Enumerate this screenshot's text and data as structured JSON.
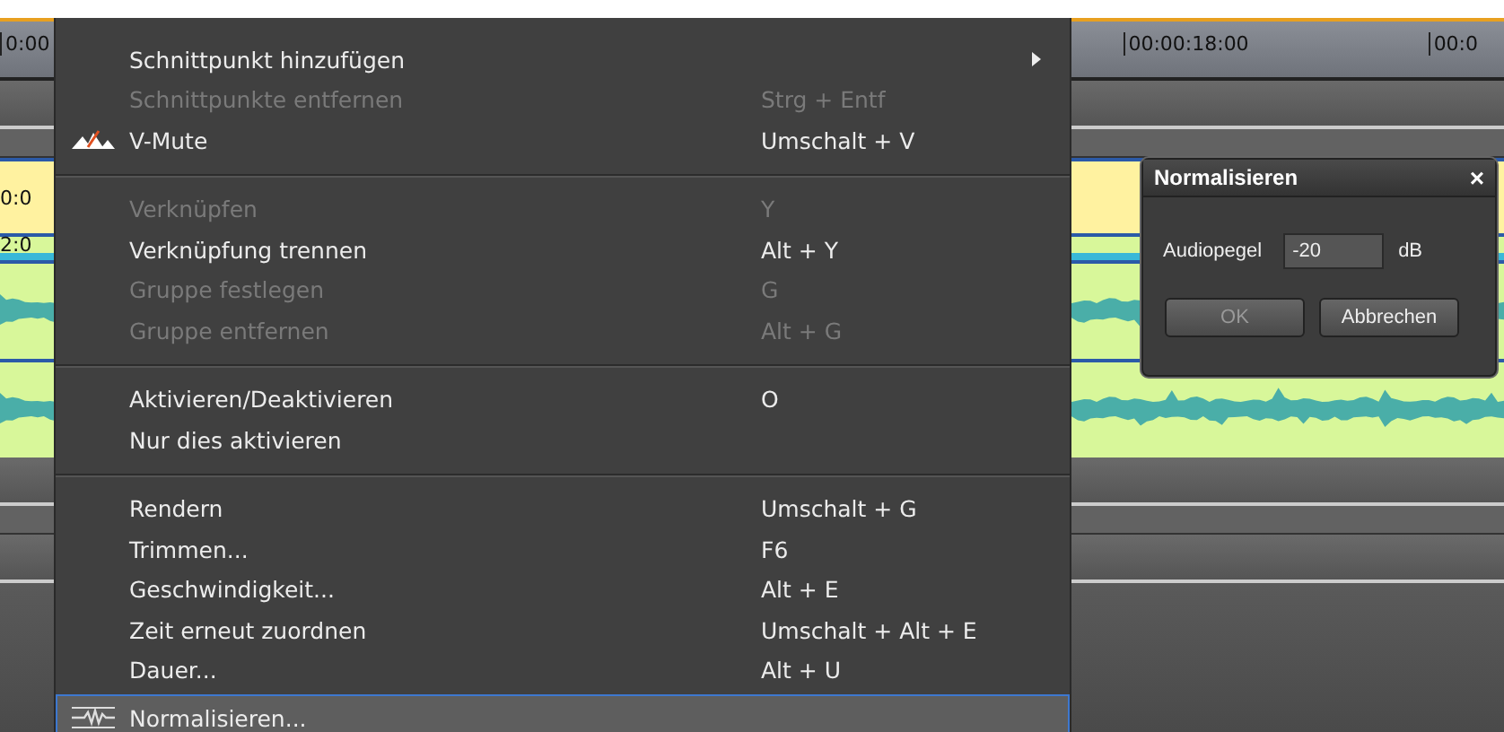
{
  "timeline": {
    "ruler_labels": [
      "0:00",
      "00:00:18:00",
      "00:0"
    ],
    "tracks": [
      {
        "kind": "band"
      },
      {
        "kind": "band-light"
      },
      {
        "kind": "video",
        "label": "0:0"
      },
      {
        "kind": "title",
        "label": "2:0"
      },
      {
        "kind": "audio"
      },
      {
        "kind": "audio"
      },
      {
        "kind": "band"
      },
      {
        "kind": "band-light"
      },
      {
        "kind": "band"
      }
    ]
  },
  "menu": {
    "items": [
      {
        "kind": "plain",
        "label": "Schnittpunkt hinzufügen",
        "disabled": false,
        "submenu": true,
        "selected": false
      },
      {
        "kind": "plain",
        "label": "Schnittpunkte entfernen",
        "shortcut": "Strg + Entf",
        "disabled": true,
        "submenu": false,
        "selected": false
      },
      {
        "kind": "mute",
        "label": "V-Mute",
        "shortcut": "Umschalt + V",
        "disabled": false,
        "submenu": false,
        "selected": false
      },
      {
        "kind": "separator"
      },
      {
        "kind": "plain",
        "label": "Verknüpfen",
        "shortcut": "Y",
        "disabled": true,
        "submenu": false,
        "selected": false
      },
      {
        "kind": "plain",
        "label": "Verknüpfung trennen",
        "shortcut": "Alt + Y",
        "disabled": false,
        "submenu": false,
        "selected": false
      },
      {
        "kind": "plain",
        "label": "Gruppe festlegen",
        "shortcut": "G",
        "disabled": true,
        "submenu": false,
        "selected": false
      },
      {
        "kind": "plain",
        "label": "Gruppe entfernen",
        "shortcut": "Alt + G",
        "disabled": true,
        "submenu": false,
        "selected": false
      },
      {
        "kind": "separator"
      },
      {
        "kind": "plain",
        "label": "Aktivieren/Deaktivieren",
        "shortcut": "O",
        "disabled": false,
        "submenu": false,
        "selected": false
      },
      {
        "kind": "plain",
        "label": "Nur dies aktivieren",
        "disabled": false,
        "submenu": false,
        "selected": false
      },
      {
        "kind": "separator"
      },
      {
        "kind": "plain",
        "label": "Rendern",
        "shortcut": "Umschalt + G",
        "disabled": false,
        "submenu": false,
        "selected": false
      },
      {
        "kind": "plain",
        "label": "Trimmen...",
        "shortcut": "F6",
        "disabled": false,
        "submenu": false,
        "selected": false
      },
      {
        "kind": "plain",
        "label": "Geschwindigkeit...",
        "shortcut": "Alt + E",
        "disabled": false,
        "submenu": false,
        "selected": false
      },
      {
        "kind": "plain",
        "label": "Zeit erneut zuordnen",
        "shortcut": "Umschalt + Alt + E",
        "disabled": false,
        "submenu": false,
        "selected": false
      },
      {
        "kind": "plain",
        "label": "Dauer...",
        "shortcut": "Alt + U",
        "disabled": false,
        "submenu": false,
        "selected": false
      },
      {
        "kind": "normalize",
        "label": "Normalisieren...",
        "disabled": false,
        "submenu": false,
        "selected": true
      }
    ]
  },
  "dialog": {
    "title": "Normalisieren",
    "close": "×",
    "field_label": "Audiopegel",
    "value": "-20",
    "unit": "dB",
    "buttons": [
      {
        "label": "OK",
        "disabled": true
      },
      {
        "label": "Abbrechen",
        "disabled": false
      }
    ]
  }
}
